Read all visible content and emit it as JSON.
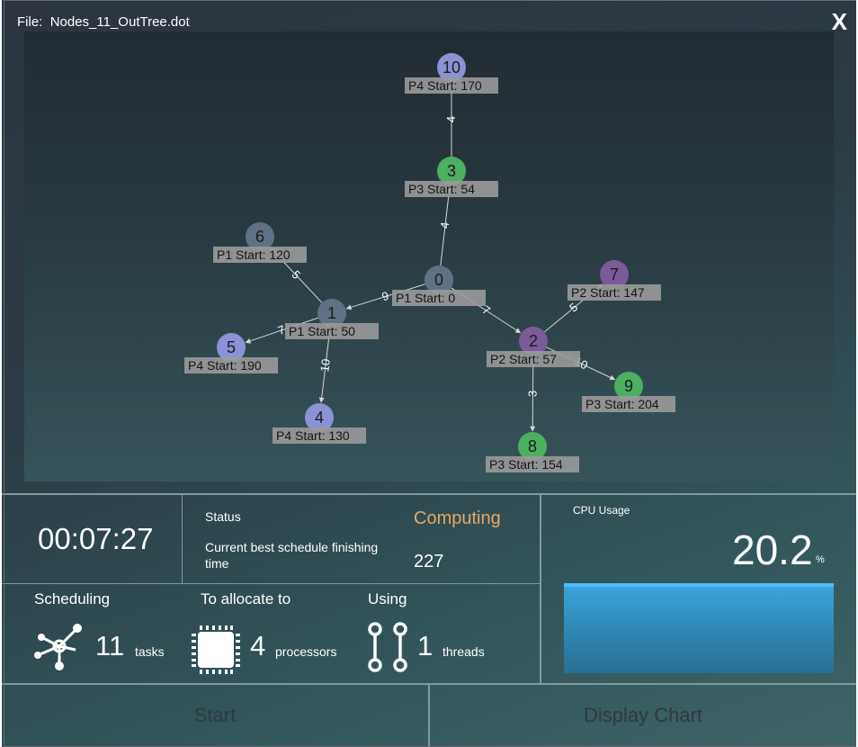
{
  "header": {
    "file_label": "File:",
    "file_name": "Nodes_11_OutTree.dot",
    "close": "X"
  },
  "graph": {
    "nodes": [
      {
        "id": "10",
        "processor": "P4",
        "start": "Start: 170",
        "color": "#8c92d6"
      },
      {
        "id": "3",
        "processor": "P3",
        "start": "Start: 54",
        "color": "#4caf62"
      },
      {
        "id": "0",
        "processor": "P1",
        "start": "Start: 0",
        "color": "#5f7285"
      },
      {
        "id": "6",
        "processor": "P1",
        "start": "Start: 120",
        "color": "#5f7285"
      },
      {
        "id": "1",
        "processor": "P1",
        "start": "Start: 50",
        "color": "#5f7285"
      },
      {
        "id": "5",
        "processor": "P4",
        "start": "Start: 190",
        "color": "#8c92d6"
      },
      {
        "id": "4",
        "processor": "P4",
        "start": "Start: 130",
        "color": "#8c92d6"
      },
      {
        "id": "7",
        "processor": "P2",
        "start": "Start: 147",
        "color": "#7c5a9a"
      },
      {
        "id": "2",
        "processor": "P2",
        "start": "Start: 57",
        "color": "#7c5a9a"
      },
      {
        "id": "9",
        "processor": "P3",
        "start": "Start: 204",
        "color": "#4caf62"
      },
      {
        "id": "8",
        "processor": "P3",
        "start": "Start: 154",
        "color": "#4caf62"
      }
    ],
    "edges": [
      {
        "from": "3",
        "to": "10",
        "weight": "4"
      },
      {
        "from": "0",
        "to": "3",
        "weight": "4"
      },
      {
        "from": "0",
        "to": "1",
        "weight": "9"
      },
      {
        "from": "0",
        "to": "2",
        "weight": "7"
      },
      {
        "from": "1",
        "to": "6",
        "weight": "5"
      },
      {
        "from": "1",
        "to": "5",
        "weight": "7"
      },
      {
        "from": "1",
        "to": "4",
        "weight": "10"
      },
      {
        "from": "2",
        "to": "7",
        "weight": "5"
      },
      {
        "from": "2",
        "to": "9",
        "weight": "10"
      },
      {
        "from": "2",
        "to": "8",
        "weight": "3"
      }
    ]
  },
  "timer": "00:07:27",
  "status": {
    "label": "Status",
    "value": "Computing",
    "value_color": "#e8a765"
  },
  "best": {
    "label": "Current best schedule finishing time",
    "value": "227"
  },
  "scheduling": {
    "header": "Scheduling",
    "count": "11",
    "unit": "tasks",
    "icon": "network-icon"
  },
  "allocate": {
    "header": "To allocate to",
    "count": "4",
    "unit": "processors",
    "icon": "chip-icon"
  },
  "using": {
    "header": "Using",
    "count": "1",
    "unit": "threads",
    "icon": "thread-icon"
  },
  "cpu": {
    "label": "CPU Usage",
    "value": "20.2",
    "unit": "%",
    "bar_color": "#3ba6dd"
  },
  "buttons": {
    "start": "Start",
    "display_chart": "Display Chart"
  }
}
